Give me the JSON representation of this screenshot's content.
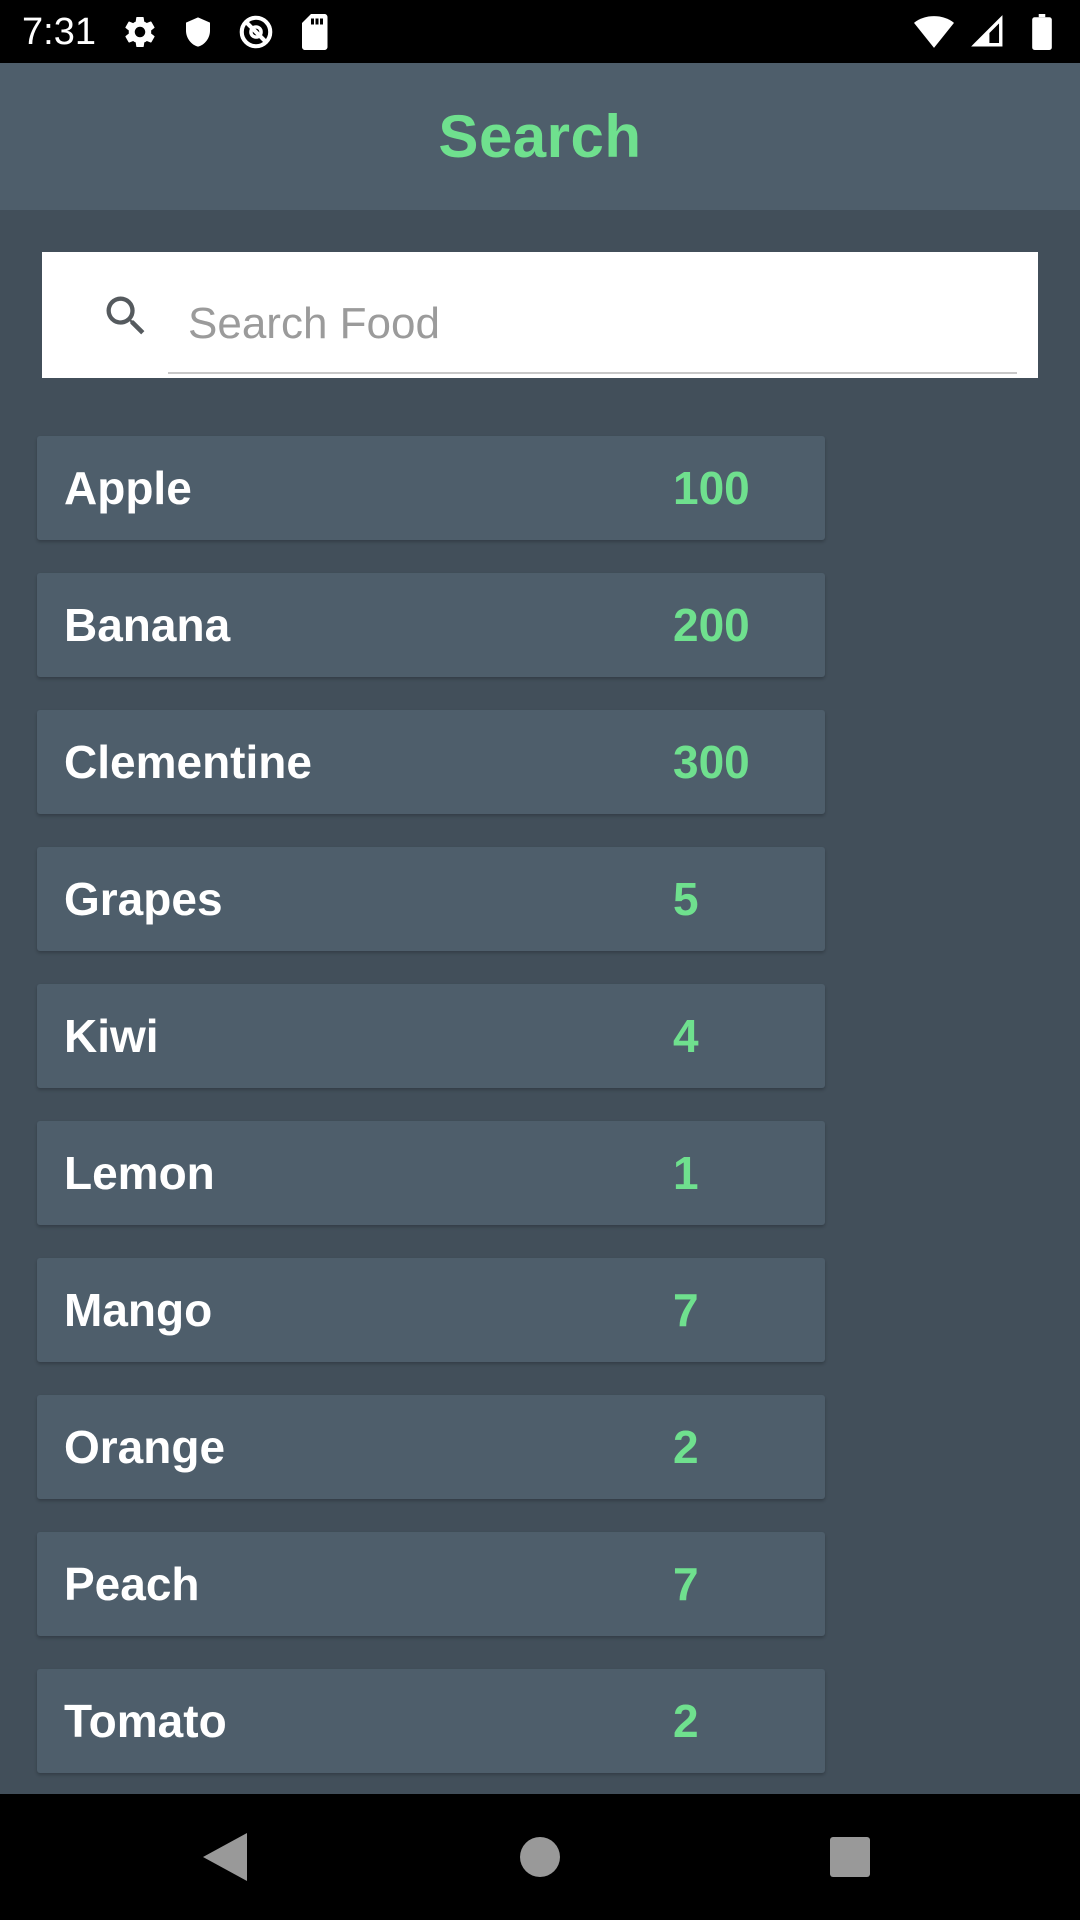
{
  "status_bar": {
    "time": "7:31",
    "left_icons": [
      "settings-icon",
      "shield-icon",
      "data-saver-icon",
      "sd-card-icon"
    ],
    "right_icons": [
      "wifi-icon",
      "cell-signal-icon",
      "battery-icon"
    ]
  },
  "app_bar": {
    "title": "Search"
  },
  "search": {
    "placeholder": "Search Food",
    "value": "",
    "icon": "search-icon"
  },
  "foods": [
    {
      "name": "Apple",
      "value": "100"
    },
    {
      "name": "Banana",
      "value": "200"
    },
    {
      "name": "Clementine",
      "value": "300"
    },
    {
      "name": "Grapes",
      "value": "5"
    },
    {
      "name": "Kiwi",
      "value": "4"
    },
    {
      "name": "Lemon",
      "value": "1"
    },
    {
      "name": "Mango",
      "value": "7"
    },
    {
      "name": "Orange",
      "value": "2"
    },
    {
      "name": "Peach",
      "value": "7"
    },
    {
      "name": "Tomato",
      "value": "2"
    }
  ],
  "nav_bar": {
    "buttons": [
      "back-icon",
      "home-icon",
      "recents-icon"
    ]
  },
  "colors": {
    "accent": "#6fe08e",
    "background": "#424f5a",
    "surface": "#4e5e6b"
  }
}
